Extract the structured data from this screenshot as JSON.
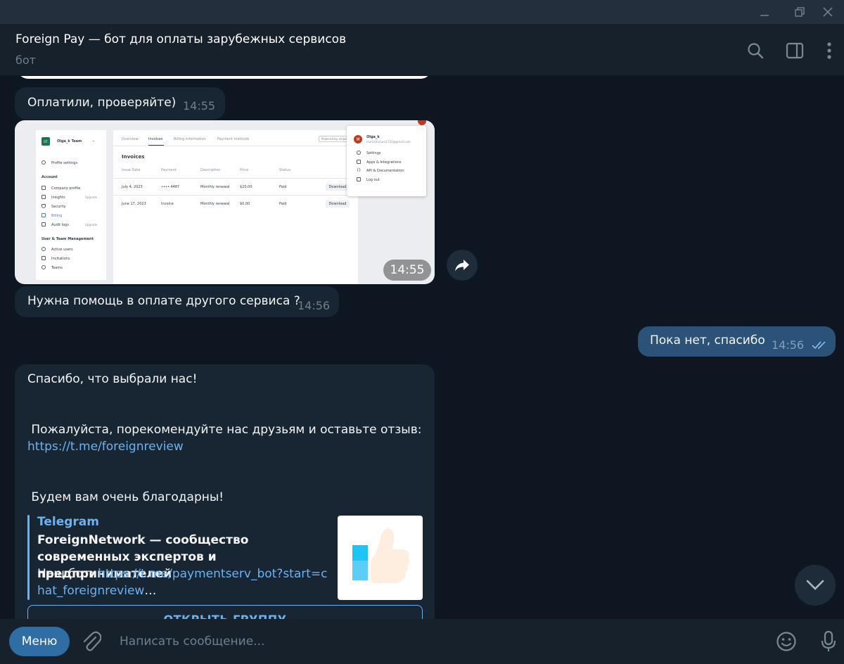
{
  "window": {
    "title": "Foreign Pay — бот для оплаты зарубежных сервисов",
    "subtitle": "бот"
  },
  "messages": [
    {
      "id": "m1",
      "direction": "in",
      "text": "Оплатили, проверяйте)",
      "time": "14:55"
    },
    {
      "id": "m2",
      "direction": "in",
      "type": "photo",
      "time": "14:55",
      "image": {
        "team": "Olga_k Team",
        "team_badge": "OT",
        "tabs": [
          "Overview",
          "Invoices",
          "Billing information",
          "Payment methods"
        ],
        "powered_by": "Powered by",
        "powered_brand": "stripe",
        "heading": "Invoices",
        "columns": [
          "Issue Date",
          "Payment",
          "Description",
          "Price",
          "Status"
        ],
        "rows": [
          {
            "date": "July 4, 2023",
            "payment": "•••• 4487",
            "description": "Monthly renewal",
            "price": "$20.00",
            "status": "Paid",
            "action": "Download"
          },
          {
            "date": "June 17, 2023",
            "payment": "Invoice",
            "description": "Monthly renewal",
            "price": "$0.00",
            "status": "Paid",
            "action": "Download"
          }
        ],
        "sidebar": {
          "profile": "Profile settings",
          "account_heading": "Account",
          "account_items": [
            "Company profile",
            "Insights",
            "Security",
            "Billing",
            "Audit logs"
          ],
          "upgrade_badge": "Upgrade",
          "team_heading": "User & Team Management",
          "team_items": [
            "Active users",
            "Invitations",
            "Teams"
          ]
        },
        "popup": {
          "avatar_letter": "M",
          "name": "Olga_k",
          "email": "marusmarusa1710@gmail.com",
          "items": [
            "Settings",
            "Apps & Integrations",
            "API & Documentation",
            "Log out"
          ]
        }
      }
    },
    {
      "id": "m3",
      "direction": "in",
      "text": "Нужна помощь в оплате другого сервиса ?",
      "time": "14:56"
    },
    {
      "id": "m4",
      "direction": "out",
      "text": "Пока нет, спасибо",
      "time": "14:56",
      "status": "read"
    },
    {
      "id": "m5",
      "direction": "in",
      "line1": "Спасибо, что выбрали нас!",
      "line2": " Пожалуйста, порекомендуйте нас друзьям и оставьте отзыв:",
      "link": "https://t.me/foreignreview",
      "line3": " Будем вам очень благодарны!",
      "preview": {
        "site": "Telegram",
        "title": "ForeignNetwork — сообщество современных экспертов и предпринимателей",
        "desc_prefix": "Наш бот: ",
        "desc_link": "https://t.me/paymentserv_bot?start=chat_foreignreview",
        "desc_suffix": "…"
      },
      "button": "ОТКРЫТЬ ГРУППУ"
    }
  ],
  "composer": {
    "menu_label": "Меню",
    "placeholder": "Написать сообщение..."
  },
  "icons": {
    "header": [
      "search-icon",
      "side-panel-icon",
      "more-vertical-icon"
    ],
    "composer": [
      "paperclip-icon",
      "emoji-icon",
      "microphone-icon"
    ],
    "window": [
      "minimize-icon",
      "restore-icon",
      "close-icon"
    ]
  },
  "colors": {
    "background": "#0e1621",
    "incoming_bubble": "#182533",
    "outgoing_bubble": "#2b5278",
    "accent": "#6ab3f3",
    "menu_button": "#2f6ea5"
  }
}
